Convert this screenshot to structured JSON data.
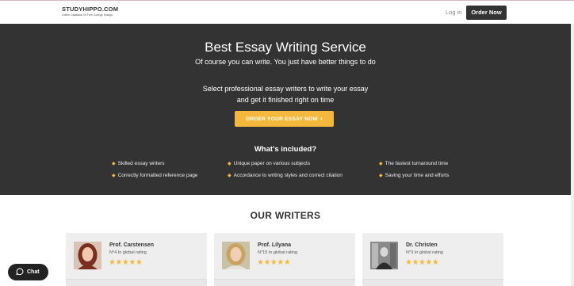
{
  "header": {
    "logo_title": "STUDYHIPPO.COM",
    "logo_subtitle": "Online Database Of Free College Essays",
    "login_label": "Log in",
    "order_label": "Order Now"
  },
  "hero": {
    "title": "Best Essay Writing Service",
    "subtitle": "Of course you can write. You just have better things to do",
    "pitch_line1": "Select professional essay writers to write your essay",
    "pitch_line2": "and get it finished right on time",
    "cta_label": "ORDER YOUR ESSAY NOW",
    "cta_arrow": "›",
    "included_title": "What’s included?",
    "features": [
      "Skilled essay writers",
      "Unique paper on various subjects",
      "The fastest turnaround time",
      "Correctly formatted reference page",
      "Accordance to writing styles and correct citation",
      "Saving your time and efforts"
    ]
  },
  "writers": {
    "title": "OUR WRITERS",
    "items": [
      {
        "name": "Prof. Carstensen",
        "rank": "N°4 In global rating",
        "stars": "★★★★★",
        "rating": 5
      },
      {
        "name": "Prof. Lilyana",
        "rank": "N°15 In global rating",
        "stars": "★★★★★",
        "rating": 5
      },
      {
        "name": "Dr. Christen",
        "rank": "N°3 In global rating",
        "stars": "★★★★★",
        "rating": 5
      }
    ]
  },
  "chat": {
    "label": "Chat"
  },
  "colors": {
    "hero_bg": "#333333",
    "accent": "#f4b93c",
    "card_bg": "#eeeeee"
  }
}
